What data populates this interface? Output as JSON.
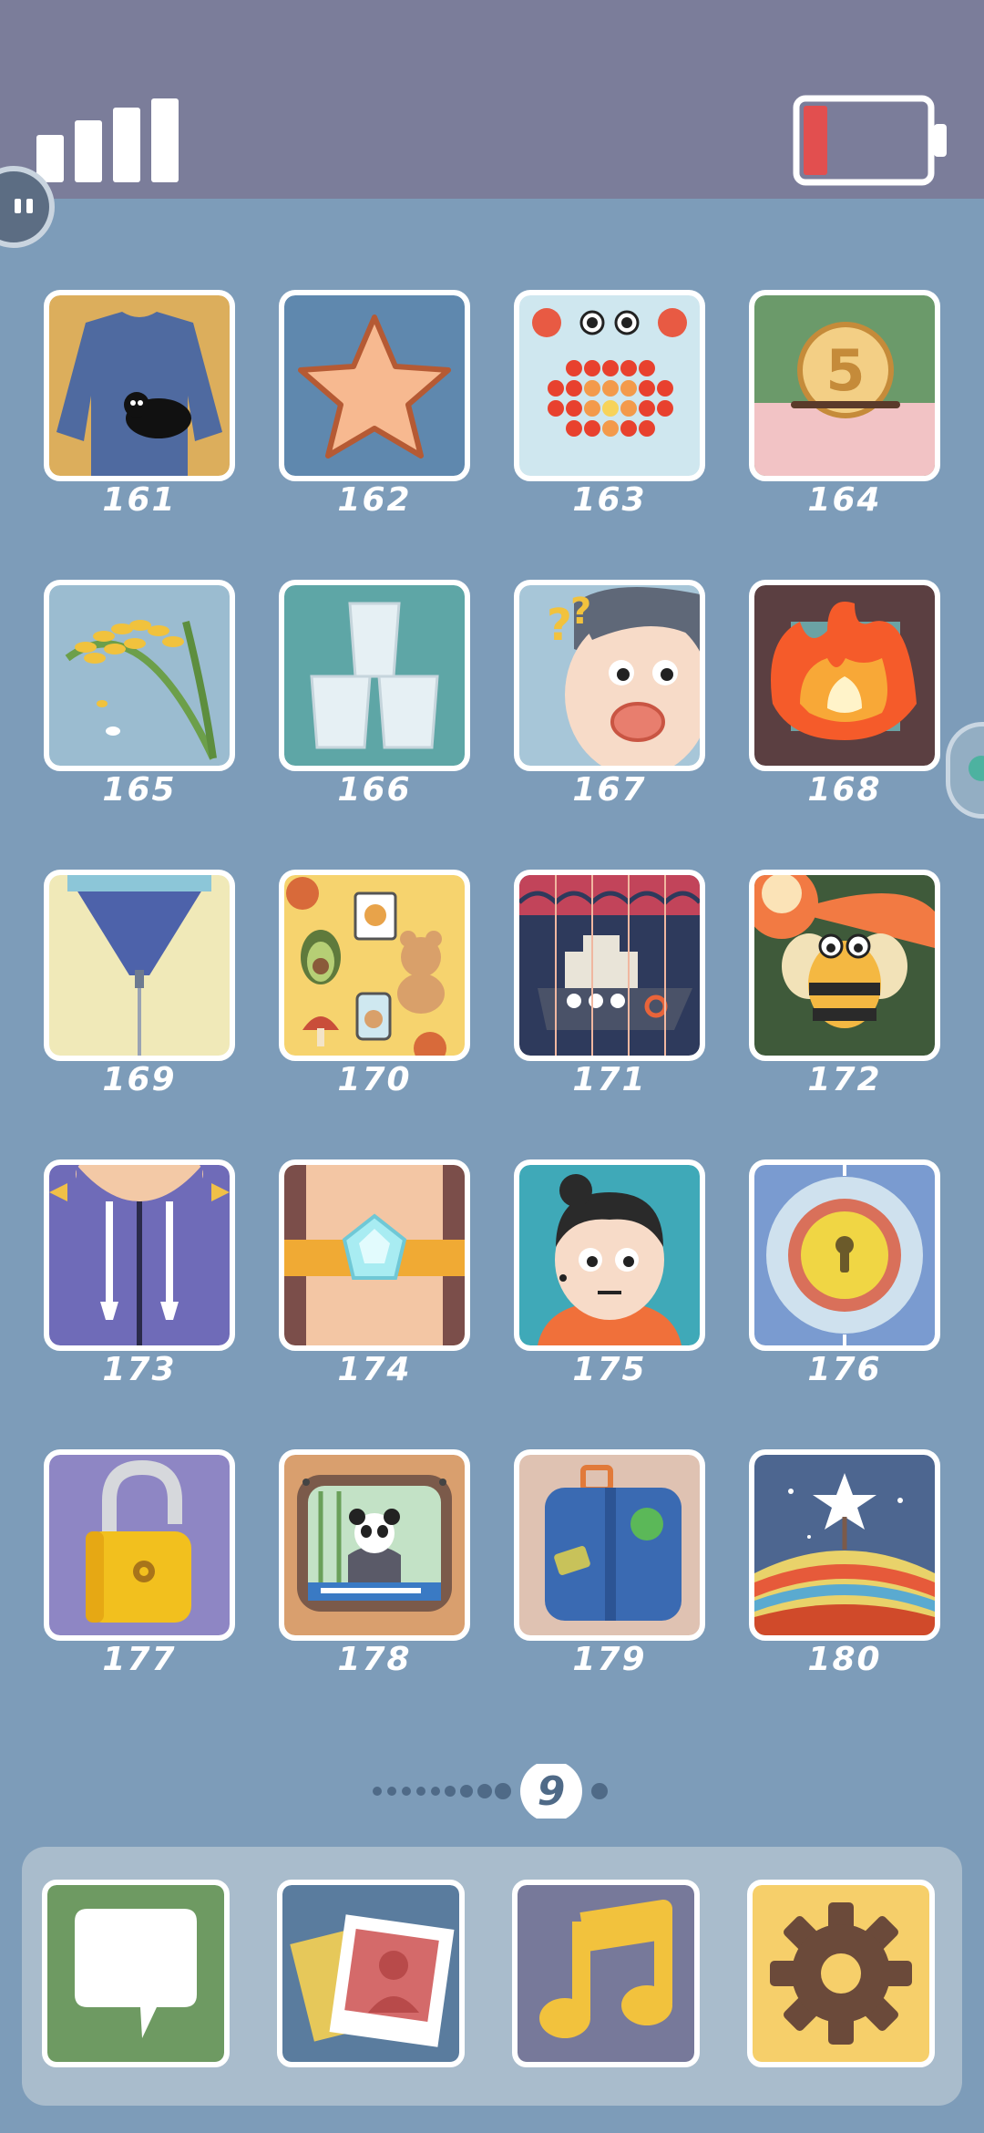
{
  "status_bar": {
    "signal_icon": "signal-bars-icon",
    "signal_bars": 4,
    "battery_icon": "battery-low-icon",
    "battery_level": 0.15
  },
  "levels": [
    {
      "number": "161",
      "icon": "sweater-cat-icon"
    },
    {
      "number": "162",
      "icon": "star-icon"
    },
    {
      "number": "163",
      "icon": "crab-icon"
    },
    {
      "number": "164",
      "icon": "coin-piggybank-icon"
    },
    {
      "number": "165",
      "icon": "rice-plant-icon"
    },
    {
      "number": "166",
      "icon": "stacked-cups-icon"
    },
    {
      "number": "167",
      "icon": "confused-face-icon"
    },
    {
      "number": "168",
      "icon": "fire-icon"
    },
    {
      "number": "169",
      "icon": "zipper-icon"
    },
    {
      "number": "170",
      "icon": "stickers-pattern-icon"
    },
    {
      "number": "171",
      "icon": "ship-icon"
    },
    {
      "number": "172",
      "icon": "bee-icon"
    },
    {
      "number": "173",
      "icon": "hoodie-icon"
    },
    {
      "number": "174",
      "icon": "diamond-ring-icon"
    },
    {
      "number": "175",
      "icon": "girl-portrait-icon"
    },
    {
      "number": "176",
      "icon": "safe-lock-icon"
    },
    {
      "number": "177",
      "icon": "padlock-icon"
    },
    {
      "number": "178",
      "icon": "panda-tv-icon"
    },
    {
      "number": "179",
      "icon": "suitcase-icon"
    },
    {
      "number": "180",
      "icon": "birthday-cake-icon"
    }
  ],
  "pager": {
    "current_page": "9",
    "dots_before": 8,
    "dots_after": 1
  },
  "dock": [
    {
      "name": "messages",
      "icon": "speech-bubble-icon",
      "bg": "#6e9a62"
    },
    {
      "name": "photos",
      "icon": "photo-icon",
      "bg": "#5a7c9e"
    },
    {
      "name": "music",
      "icon": "music-note-icon",
      "bg": "#77799a"
    },
    {
      "name": "settings",
      "icon": "gear-icon",
      "bg": "#f6cf6a"
    }
  ]
}
